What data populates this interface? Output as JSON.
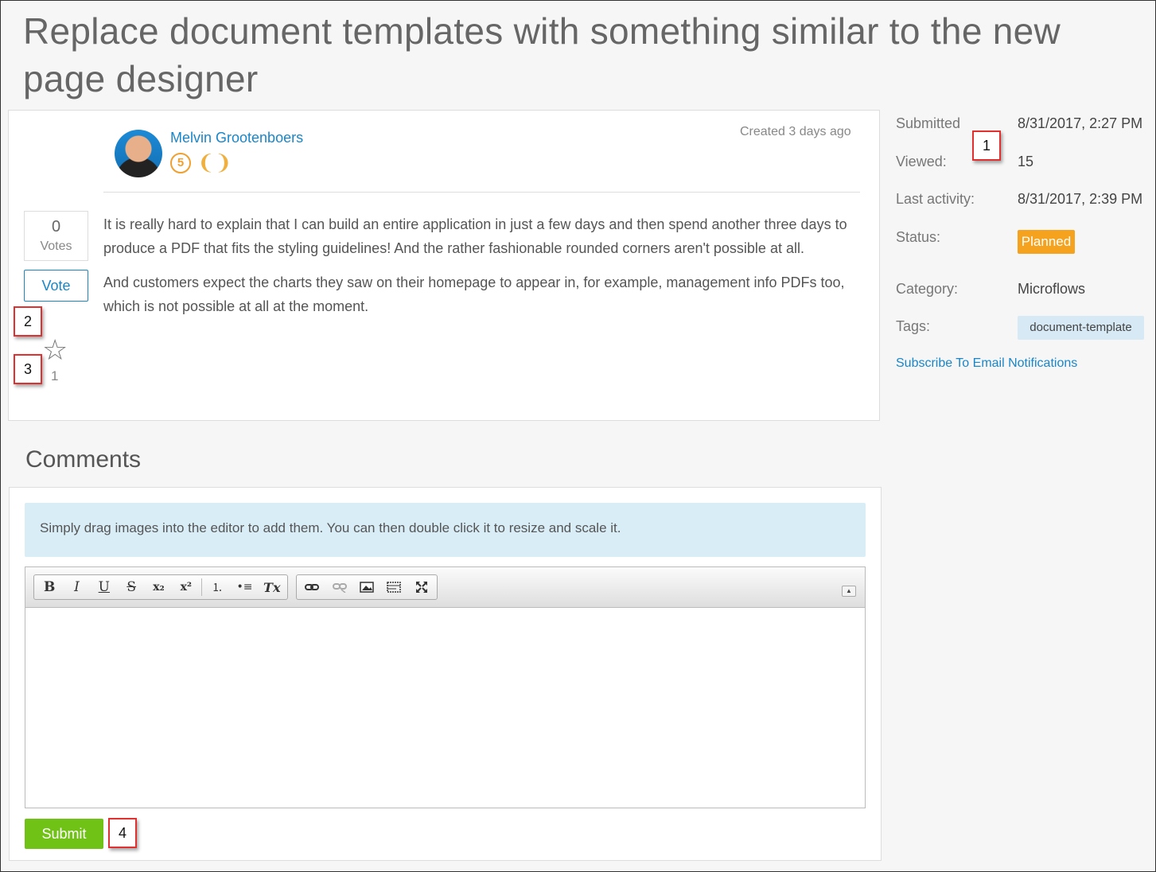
{
  "page_title": "Replace document templates with something similar to the new page designer",
  "post": {
    "author": "Melvin Grootenboers",
    "rank_badge": "5",
    "created": "Created 3 days ago",
    "votes_count": "0",
    "votes_label": "Votes",
    "vote_button": "Vote",
    "favorites_count": "1",
    "paragraphs": [
      "It is really hard to explain that I can build an entire application in just a few days and then spend another three days to produce a PDF that fits the styling guidelines! And the rather fashionable rounded corners aren't possible at all.",
      "And customers expect the charts they saw on their homepage to appear in, for example, management info PDFs too, which is not possible at all at the moment."
    ]
  },
  "meta": {
    "submitted_label": "Submitted",
    "submitted_value": "8/31/2017, 2:27 PM",
    "viewed_label": "Viewed:",
    "viewed_value": "15",
    "last_activity_label": "Last activity:",
    "last_activity_value": "8/31/2017, 2:39 PM",
    "status_label": "Status:",
    "status_value": "Planned",
    "category_label": "Category:",
    "category_value": "Microflows",
    "tags_label": "Tags:",
    "tag_value": "document-template",
    "subscribe_link": "Subscribe To Email Notifications"
  },
  "comments": {
    "title": "Comments",
    "info": "Simply drag images into the editor to add them. You can then double click it to resize and scale it.",
    "submit_button": "Submit"
  },
  "toolbar": {
    "bold": "B",
    "italic": "I",
    "underline": "U",
    "strike": "S",
    "subscript": "x₂",
    "superscript": "x²",
    "numbered_list": "⒈",
    "bulleted_list": "•≡",
    "remove_format": "Tx"
  },
  "callouts": [
    "1",
    "2",
    "3",
    "4"
  ],
  "colors": {
    "accent": "#1a86c9",
    "status_planned": "#f5a21e",
    "submit": "#70c316",
    "callout_border": "#e03030"
  }
}
